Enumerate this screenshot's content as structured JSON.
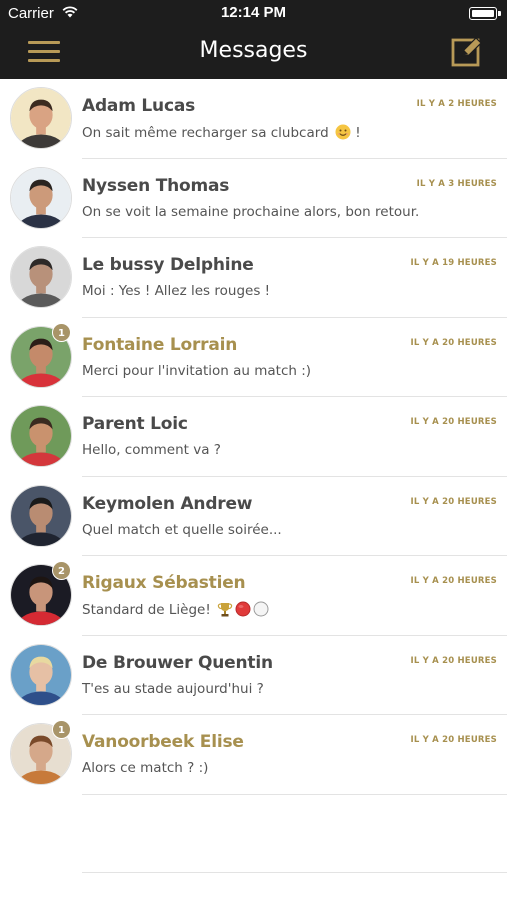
{
  "status_bar": {
    "carrier": "Carrier",
    "time": "12:14 PM",
    "icons": [
      "wifi-icon",
      "battery-icon"
    ]
  },
  "nav": {
    "title": "Messages",
    "left_icon": "menu-icon",
    "right_icon": "compose-icon",
    "accent_color": "#b89a57",
    "background_color": "#1d1d1d"
  },
  "conversations": [
    {
      "name": "Adam Lucas",
      "message": "On sait même recharger sa clubcard",
      "message_suffix": " !",
      "emoji": "smile-emoji",
      "time": "IL Y A 2 HEURES",
      "unread": false,
      "badge": ""
    },
    {
      "name": "Nyssen Thomas",
      "message": "On se voit la semaine prochaine alors, bon retour.",
      "time": "IL Y A 3 HEURES",
      "unread": false,
      "badge": ""
    },
    {
      "name": "Le bussy Delphine",
      "message": "Moi : Yes ! Allez les rouges !",
      "time": "IL Y A 19 HEURES",
      "unread": false,
      "badge": ""
    },
    {
      "name": "Fontaine Lorrain",
      "message": "Merci pour l'invitation au match :)",
      "time": "IL Y A 20 HEURES",
      "unread": true,
      "badge": "1"
    },
    {
      "name": "Parent Loic",
      "message": "Hello, comment va ?",
      "time": "IL Y A 20 HEURES",
      "unread": false,
      "badge": ""
    },
    {
      "name": "Keymolen Andrew",
      "message": "Quel match et quelle soirée...",
      "time": "IL Y A 20 HEURES",
      "unread": false,
      "badge": ""
    },
    {
      "name": "Rigaux Sébastien",
      "message": "Standard de Liège!",
      "emoji": "trophy-red-white-emoji",
      "time": "IL Y A 20 HEURES",
      "unread": true,
      "badge": "2"
    },
    {
      "name": "De Brouwer Quentin",
      "message": "T'es au stade aujourd'hui ?",
      "time": "IL Y A 20 HEURES",
      "unread": false,
      "badge": ""
    },
    {
      "name": "Vanoorbeek Elise",
      "message": "Alors ce match ? :)",
      "time": "IL Y A 20 HEURES",
      "unread": true,
      "badge": "1"
    }
  ],
  "colors": {
    "unread_name": "#a7904f",
    "time_text": "#a7904f",
    "badge_bg": "#a89468"
  }
}
